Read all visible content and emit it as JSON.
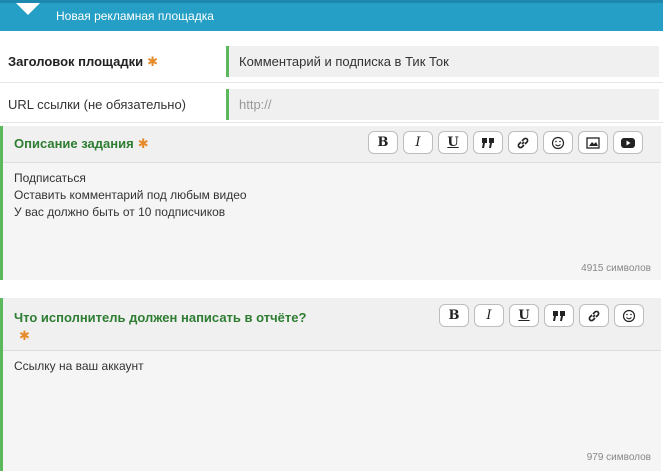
{
  "header": {
    "title": "Новая рекламная площадка"
  },
  "form": {
    "title_label": "Заголовок площадки",
    "title_value": "Комментарий и подписка в Тик Ток",
    "url_label": "URL ссылки (не обязательно)",
    "url_placeholder": "http://",
    "required_mark": "✱"
  },
  "description_editor": {
    "label": "Описание задания",
    "lines": [
      "Подписаться",
      "Оставить комментарий под любым видео",
      "У вас должно быть от 10 подписчиков"
    ],
    "counter": "4915 символов",
    "toolbar": [
      "B",
      "I",
      "U",
      "quote-icon",
      "link-icon",
      "smile-icon",
      "image-icon",
      "video-icon"
    ]
  },
  "report_editor": {
    "label": "Что исполнитель должен написать в отчёте?",
    "lines": [
      "Ссылку на ваш аккаунт"
    ],
    "counter": "979 символов",
    "toolbar": [
      "B",
      "I",
      "U",
      "quote-icon",
      "link-icon",
      "smile-icon"
    ]
  }
}
